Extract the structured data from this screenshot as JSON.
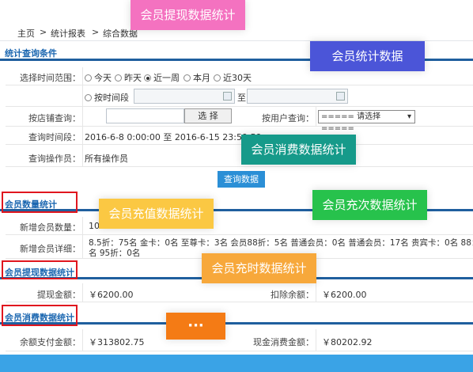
{
  "breadcrumb": {
    "home": "主页",
    "sep1": ">",
    "reports": "统计报表",
    "sep2": ">",
    "current": "综合数据"
  },
  "query": {
    "section_title": "统计查询条件",
    "time_range_label": "选择时间范围：",
    "time_options": [
      "今天",
      "昨天",
      "近一周",
      "本月",
      "近30天"
    ],
    "selected_option": "近一周",
    "by_period_label": "按时间段",
    "to_label": "至",
    "store_label": "按店铺查询：",
    "select_button": "选 择",
    "user_label": "按用户查询：",
    "user_select": "===== 请选择 =====",
    "period_label": "查询时间段：",
    "period_value": "2016-6-8 0:00:00 至 2016-6-15 23:59:59",
    "operator_label": "查询操作员：",
    "operator_value": "所有操作员",
    "query_button": "查询数据"
  },
  "member_count": {
    "section_title": "会员数量统计",
    "new_count_label": "新增会员数量：",
    "new_count_value": "100",
    "new_detail_label": "新增会员详细：",
    "new_detail_line1": "8.5折：75名 金卡：0名 至尊卡：3名 会员88折：5名 普通会员：0名 普通会员：17名 贵宾卡：0名 88：0",
    "new_detail_line2": "名 95折：0名"
  },
  "withdraw": {
    "section_title": "会员提现数据统计",
    "amount_label": "提现金额：",
    "amount_value": "￥6200.00",
    "deduct_label": "扣除余额：",
    "deduct_value": "￥6200.00"
  },
  "consume": {
    "section_title": "会员消费数据统计",
    "balance_pay_label": "余额支付金额：",
    "balance_pay_value": "￥313802.75",
    "cash_label": "现金消费金额：",
    "cash_value": "￥80202.92"
  },
  "overlay_tags": {
    "withdraw_stats": "会员提现数据统计",
    "member_stats": "会员统计数据",
    "consume_stats": "会员消费数据统计",
    "recharge_value": "会员充值数据统计",
    "recharge_times": "会员充次数据统计",
    "recharge_hours": "会员充时数据统计",
    "more": "···"
  },
  "colors": {
    "accent": "#1f5f9e",
    "query_button": "#2b8fd6",
    "highlight_border": "#e0161e",
    "bottom_bar": "#3aa3e6",
    "tag_pink": "#f472c0",
    "tag_blue": "#4b55d8",
    "tag_teal": "#169a8a",
    "tag_yellow": "#fbc843",
    "tag_green": "#27c24c",
    "tag_orange": "#f7a83b",
    "tag_orange2": "#f47b15"
  }
}
